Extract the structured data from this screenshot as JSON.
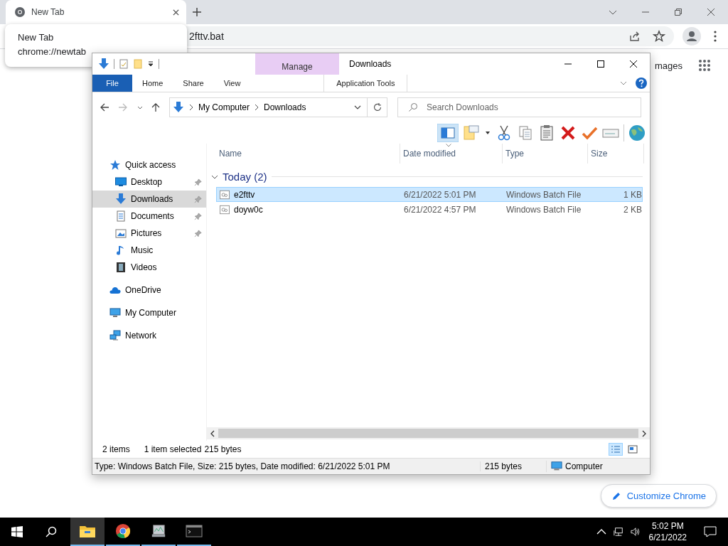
{
  "browser": {
    "tabs": [
      {
        "title": "New Tab",
        "selected": true
      }
    ],
    "tooltip": {
      "title": "New Tab",
      "url": "chrome://newtab"
    },
    "address_bar": {
      "value": "2fttv.bat"
    },
    "page": {
      "link": "mages",
      "customize_button": "Customize Chrome"
    }
  },
  "explorer": {
    "title": "Downloads",
    "contextual_tab": {
      "group": "Manage",
      "label": "Application Tools"
    },
    "ribbon_tabs": [
      {
        "label": "File",
        "kind": "file"
      },
      {
        "label": "Home",
        "kind": "tab"
      },
      {
        "label": "Share",
        "kind": "tab"
      },
      {
        "label": "View",
        "kind": "tab"
      }
    ],
    "breadcrumb": [
      "My Computer",
      "Downloads"
    ],
    "search": {
      "placeholder": "Search Downloads"
    },
    "sidebar": [
      {
        "label": "Quick access",
        "kind": "star",
        "selected": false,
        "children": [
          {
            "label": "Desktop",
            "kind": "desktop",
            "pinned": true,
            "selected": false
          },
          {
            "label": "Downloads",
            "kind": "download",
            "pinned": true,
            "selected": true
          },
          {
            "label": "Documents",
            "kind": "document",
            "pinned": true,
            "selected": false
          },
          {
            "label": "Pictures",
            "kind": "picture",
            "pinned": true,
            "selected": false
          },
          {
            "label": "Music",
            "kind": "music",
            "pinned": false,
            "selected": false
          },
          {
            "label": "Videos",
            "kind": "video",
            "pinned": false,
            "selected": false
          }
        ]
      },
      {
        "label": "OneDrive",
        "kind": "cloud",
        "selected": false
      },
      {
        "label": "My Computer",
        "kind": "computer",
        "selected": false
      },
      {
        "label": "Network",
        "kind": "network",
        "selected": false
      }
    ],
    "columns": [
      {
        "label": "Name",
        "sorted": false
      },
      {
        "label": "Date modified",
        "sorted": true
      },
      {
        "label": "Type",
        "sorted": false
      },
      {
        "label": "Size",
        "sorted": false
      }
    ],
    "group": {
      "label": "Today (2)",
      "expanded": true
    },
    "rows": [
      {
        "name": "e2fttv",
        "date": "6/21/2022 5:01 PM",
        "type": "Windows Batch File",
        "size": "1 KB",
        "selected": true
      },
      {
        "name": "doyw0c",
        "date": "6/21/2022 4:57 PM",
        "type": "Windows Batch File",
        "size": "2 KB",
        "selected": false
      }
    ],
    "status": {
      "count": "2 items",
      "selection": "1 item selected",
      "size": "215 bytes"
    },
    "views": [
      {
        "kind": "details",
        "selected": true
      },
      {
        "kind": "tiles",
        "selected": false
      }
    ],
    "details_bar": {
      "text": "Type: Windows Batch File, Size: 215 bytes, Date modified: 6/21/2022 5:01 PM",
      "size": "215 bytes",
      "location": "Computer"
    }
  },
  "taskbar": {
    "apps": [
      {
        "kind": "explorer",
        "active": true
      },
      {
        "kind": "chrome",
        "active": false
      },
      {
        "kind": "monitor",
        "active": false
      },
      {
        "kind": "console",
        "active": false
      }
    ],
    "time": "5:02 PM",
    "date": "6/21/2022"
  }
}
